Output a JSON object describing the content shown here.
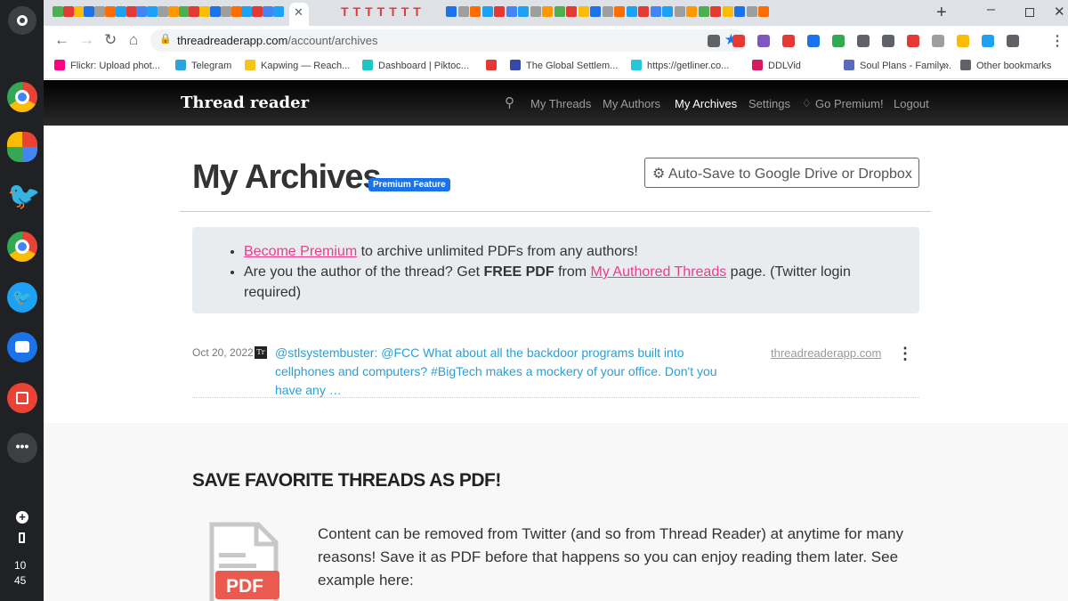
{
  "shelf": {
    "clock_hour": "10",
    "clock_min": "45"
  },
  "browser": {
    "tab_text_letters": "TTTTTTT",
    "address": {
      "domain": "threadreaderapp.com",
      "path": "/account/archives"
    },
    "bookmarks": [
      {
        "label": "Flickr: Upload phot...",
        "color": "#ff0084"
      },
      {
        "label": "Telegram",
        "color": "#2aa3df"
      },
      {
        "label": "Kapwing — Reach...",
        "color": "#f7c51a"
      },
      {
        "label": "Dashboard | Piktoc...",
        "color": "#1fc7c2"
      },
      {
        "label": "",
        "color": "#e53935"
      },
      {
        "label": "The Global Settlem...",
        "color": "#3949ab"
      },
      {
        "label": "https://getliner.co...",
        "color": "#26c6da"
      },
      {
        "label": "DDLVid",
        "color": "#d81b60"
      },
      {
        "label": "Soul Plans - Family...",
        "color": "#5c6bc0"
      }
    ],
    "bookmarks_more": "»",
    "other_bookmarks": "Other bookmarks"
  },
  "site": {
    "logo": "Thread reader",
    "nav": [
      "My Threads",
      "My Authors",
      "My Archives",
      "Settings",
      "Go Premium!",
      "Logout"
    ]
  },
  "page": {
    "title": "My Archives",
    "badge": "Premium Feature",
    "autosave": "Auto-Save to Google Drive or Dropbox",
    "notice": {
      "l1_link": "Become Premium",
      "l1_rest": " to archive unlimited PDFs from any authors!",
      "l2_pre": "Are you the author of the thread? Get ",
      "l2_bold": "FREE PDF",
      "l2_mid": " from ",
      "l2_link": "My Authored Threads",
      "l2_rest": " page. (Twitter login required)"
    },
    "archive": {
      "date": "Oct 20, 2022",
      "avatar": "Tr",
      "text": "@stlsystembuster: @FCC What about all the backdoor programs built into cellphones and computers? #BigTech makes a mockery of your office. Don't you have any …",
      "domain": "threadreaderapp.com",
      "menu": "⋮"
    },
    "promo": {
      "heading": "SAVE FAVORITE THREADS AS PDF!",
      "pdf_label": "PDF",
      "body": "Content can be removed from Twitter (and so from Thread Reader) at anytime for many reasons! Save it as PDF before that happens so you can enjoy reading them later. See example here:"
    }
  }
}
